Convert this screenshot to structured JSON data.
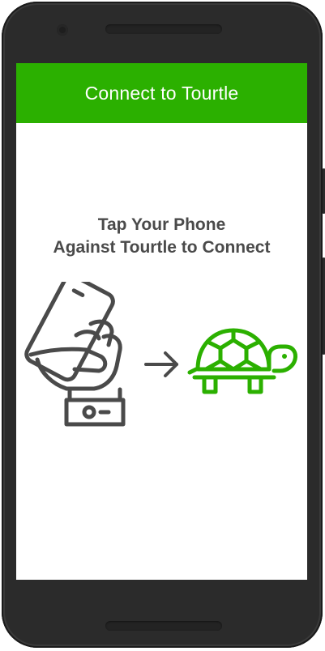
{
  "app_bar": {
    "title": "Connect to Tourtle"
  },
  "instruction": {
    "line1": "Tap Your Phone",
    "line2": "Against Tourtle to Connect"
  },
  "icons": {
    "hand": "hand-holding-phone-icon",
    "arrow": "arrow-right-icon",
    "turtle": "turtle-icon"
  },
  "colors": {
    "brand_green": "#2bb000",
    "icon_gray": "#4a4a4a",
    "title_text": "#ffffff"
  }
}
